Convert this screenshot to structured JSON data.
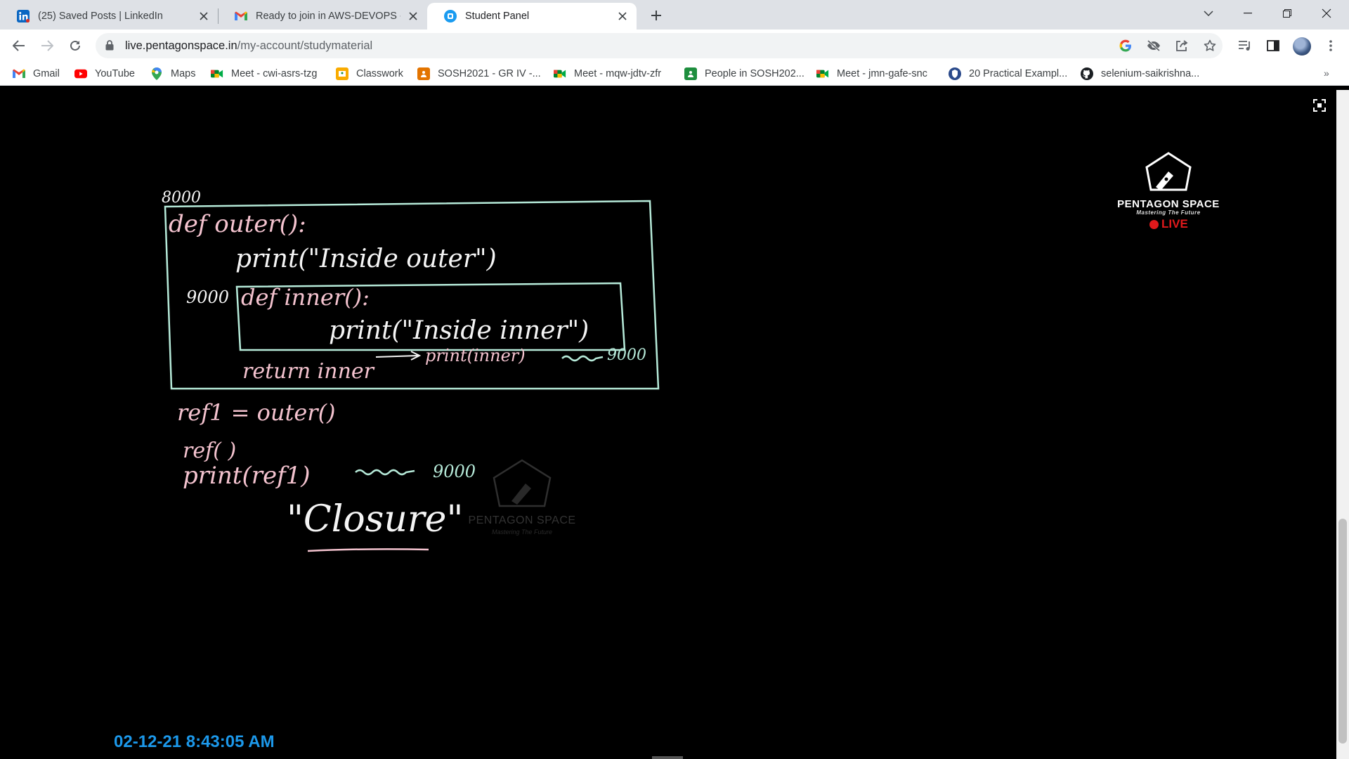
{
  "browser": {
    "tabs": [
      {
        "title": "(25) Saved Posts | LinkedIn",
        "icon": "linkedin-icon",
        "active": false
      },
      {
        "title": "Ready to join in AWS-DEVOPS - c",
        "icon": "gmail-icon",
        "active": false
      },
      {
        "title": "Student Panel",
        "icon": "student-panel-icon",
        "active": true
      }
    ],
    "address": {
      "host": "live.pentagonspace.in",
      "path": "/my-account/studymaterial"
    },
    "bookmarks": [
      {
        "label": "Gmail",
        "icon": "gmail-icon"
      },
      {
        "label": "YouTube",
        "icon": "youtube-icon"
      },
      {
        "label": "Maps",
        "icon": "maps-icon"
      },
      {
        "label": "Meet - cwi-asrs-tzg",
        "icon": "meet-icon"
      },
      {
        "label": "Classwork",
        "icon": "classroom-icon"
      },
      {
        "label": "SOSH2021 - GR IV -...",
        "icon": "classroom-icon"
      },
      {
        "label": "Meet - mqw-jdtv-zfr",
        "icon": "meet-icon"
      },
      {
        "label": "People in SOSH202...",
        "icon": "classroom-icon"
      },
      {
        "label": "Meet - jmn-gafe-snc",
        "icon": "meet-icon"
      },
      {
        "label": "20 Practical Exampl...",
        "icon": "site-icon"
      },
      {
        "label": "selenium-saikrishna...",
        "icon": "github-icon"
      }
    ],
    "more_bookmarks": "»"
  },
  "video": {
    "board": {
      "addr_outer": "8000",
      "line_def_outer": "def outer():",
      "line_print_outer": "print(\"Inside outer\")",
      "addr_inner": "9000",
      "line_def_inner": "def inner():",
      "line_print_inner": "print(\"Inside inner\")",
      "line_return": "return inner",
      "arrow_note": "print(inner)",
      "arrow_note_value": "9000",
      "line_ref_assign": "ref1 = outer()",
      "line_ref_call": "ref( )",
      "line_print_ref": "print(ref1)",
      "print_ref_value": "9000",
      "closure_label": "\"Closure\""
    },
    "logo": {
      "name": "PENTAGON SPACE",
      "tagline": "Mastering The Future",
      "live_label": "LIVE"
    },
    "watermark": {
      "name": "PENTAGON SPACE",
      "tagline": "Mastering The Future"
    },
    "timestamp": "02-12-21 8:43:05 AM",
    "colors": {
      "chalk_pink": "#f4c3cf",
      "chalk_white": "#f5f5f5",
      "chalk_green": "#b6ead9",
      "timestamp_blue": "#1c98ea",
      "live_red": "#e0191b"
    }
  }
}
